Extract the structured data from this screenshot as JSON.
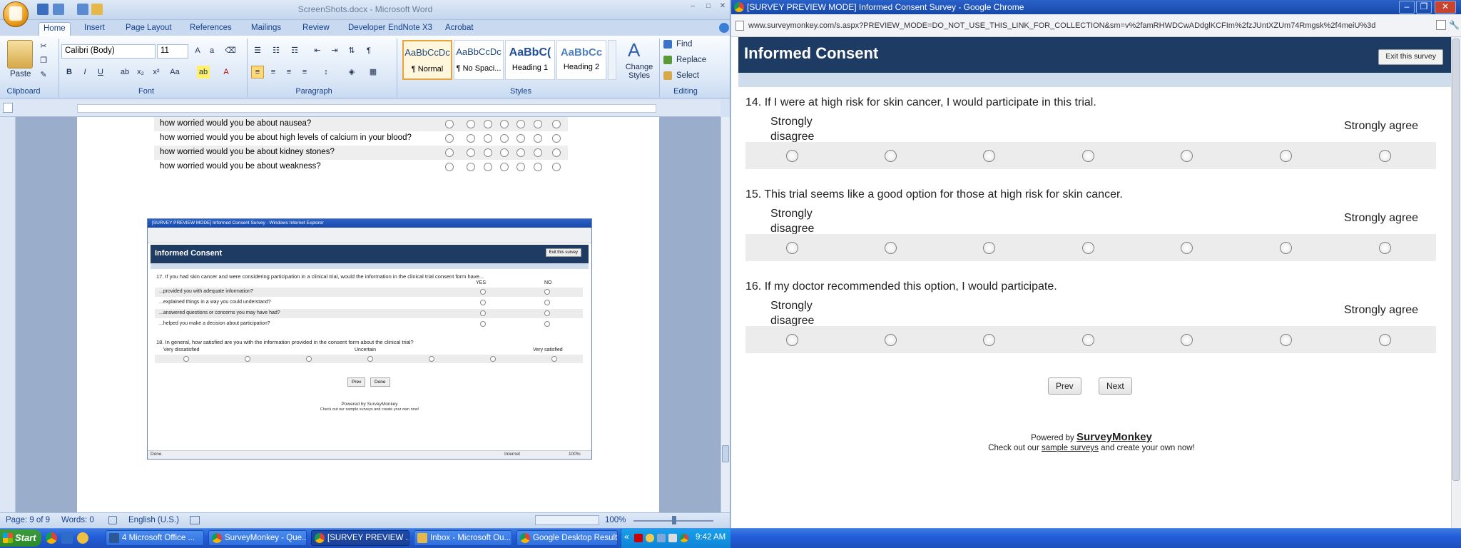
{
  "word": {
    "title": "ScreenShots.docx - Microsoft Word",
    "tabs": [
      "Home",
      "Insert",
      "Page Layout",
      "References",
      "Mailings",
      "Review",
      "Developer",
      "EndNote X3",
      "Acrobat"
    ],
    "font_name": "Calibri (Body)",
    "font_size": "11",
    "paste_label": "Paste",
    "groups": [
      "Clipboard",
      "Font",
      "Paragraph",
      "Styles",
      "Editing"
    ],
    "styles": [
      {
        "preview": "AaBbCcDc",
        "name": "¶ Normal"
      },
      {
        "preview": "AaBbCcDc",
        "name": "¶ No Spaci..."
      },
      {
        "preview": "AaBbC(",
        "name": "Heading 1"
      },
      {
        "preview": "AaBbCc",
        "name": "Heading 2"
      }
    ],
    "change_styles": "Change Styles",
    "find": "Find",
    "replace": "Replace",
    "select": "Select",
    "doc_rows": [
      "how worried would you be about nausea?",
      "how worried would you be about high levels of calcium in your blood?",
      "how worried would you be about kidney stones?",
      "how worried would you be about weakness?"
    ],
    "embedded": {
      "window_title": "[SURVEY PREVIEW MODE] Informed Consent Survey - Windows Internet Explorer",
      "header": "Informed Consent",
      "exit": "Exit this survey",
      "q17": "17. If you had skin cancer and were considering participation in a clinical trial, would the information in the clinical trial consent form have...",
      "yes": "YES",
      "no": "NO",
      "q17_rows": [
        "...provided you with adequate information?",
        "...explained things in a way you could understand?",
        "...answered questions or concerns you may have had?",
        "...helped you make a decision about participation?"
      ],
      "q18": "18. In general, how satisfied are you with the information provided in the consent form about the clinical trial?",
      "very_dissatisfied": "Very dissatisfied",
      "uncertain": "Uncertain",
      "very_satisfied": "Very satisfied",
      "prev": "Prev",
      "done": "Done",
      "powered": "Powered by SurveyMonkey",
      "checkout": "Check out our sample surveys and create your own now!",
      "status_done": "Done",
      "status_zone": "Internet",
      "status_zoom": "100%"
    },
    "status": {
      "page": "Page: 9 of 9",
      "words": "Words: 0",
      "language": "English (U.S.)",
      "zoom": "100%"
    }
  },
  "chrome": {
    "title": "[SURVEY PREVIEW MODE] Informed Consent Survey - Google Chrome",
    "url": "www.surveymonkey.com/s.aspx?PREVIEW_MODE=DO_NOT_USE_THIS_LINK_FOR_COLLECTION&sm=v%2famRHWDCwADdglKCFIm%2fzJUntXZUm74Rmgsk%2f4meiU%3d",
    "header": "Informed Consent",
    "exit_button": "Exit this survey",
    "questions": [
      {
        "text": "14. If I were at high risk for skin cancer, I would participate in this trial.",
        "low": "Strongly disagree",
        "high": "Strongly agree"
      },
      {
        "text": "15. This trial seems like a good option for those at high risk for skin cancer.",
        "low": "Strongly disagree",
        "high": "Strongly agree"
      },
      {
        "text": "16. If my doctor recommended this option, I would participate.",
        "low": "Strongly disagree",
        "high": "Strongly agree"
      }
    ],
    "prev": "Prev",
    "next": "Next",
    "powered_by": "Powered by",
    "brand": "SurveyMonkey",
    "check_pre": "Check out our",
    "sample_link": "sample surveys",
    "check_post": "and create your own now!"
  },
  "taskbar": {
    "start": "Start",
    "items": [
      "4 Microsoft Office ...",
      "SurveyMonkey - Que...",
      "[SURVEY PREVIEW ...",
      "Inbox - Microsoft Ou...",
      "Google Desktop Results"
    ],
    "clock": "9:42 AM"
  }
}
